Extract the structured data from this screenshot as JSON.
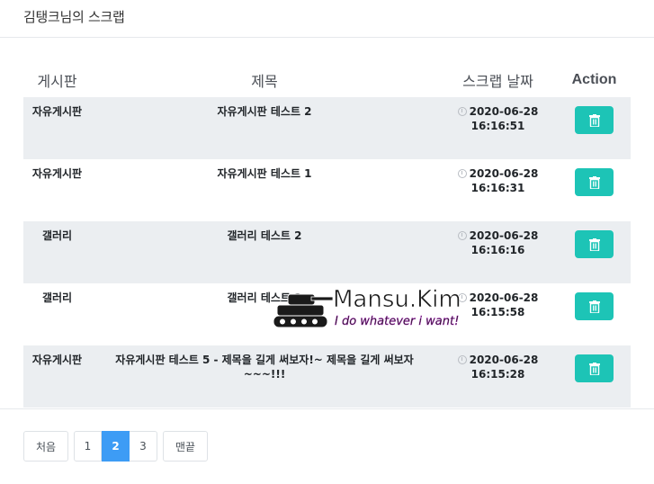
{
  "page": {
    "title": "김탱크님의 스크랩"
  },
  "table": {
    "headers": {
      "board": "게시판",
      "title": "제목",
      "date": "스크랩 날짜",
      "action": "Action"
    },
    "rows": [
      {
        "board": "자유게시판",
        "title": "자유게시판 테스트 2",
        "date": "2020-06-28",
        "time": "16:16:51"
      },
      {
        "board": "자유게시판",
        "title": "자유게시판 테스트 1",
        "date": "2020-06-28",
        "time": "16:16:31"
      },
      {
        "board": "갤러리",
        "title": "갤러리 테스트 2",
        "date": "2020-06-28",
        "time": "16:16:16"
      },
      {
        "board": "갤러리",
        "title": "갤러리 테스트 3",
        "date": "2020-06-28",
        "time": "16:15:58"
      },
      {
        "board": "자유게시판",
        "title": "자유게시판 테스트 5 - 제목을 길게 써보자!~ 제목을 길게 써보자~~~!!!",
        "date": "2020-06-28",
        "time": "16:15:28"
      }
    ],
    "action_icon": "trash-icon"
  },
  "pagination": {
    "first": "처음",
    "pages": [
      "1",
      "2",
      "3"
    ],
    "active_page": "2",
    "last": "맨끝"
  },
  "watermark": {
    "name": "Mansu.Kim",
    "tagline": "I do whatever i want!"
  },
  "colors": {
    "accent": "#1dc4b6",
    "active_page": "#3d9cf5",
    "stripe": "#ebeef1"
  }
}
